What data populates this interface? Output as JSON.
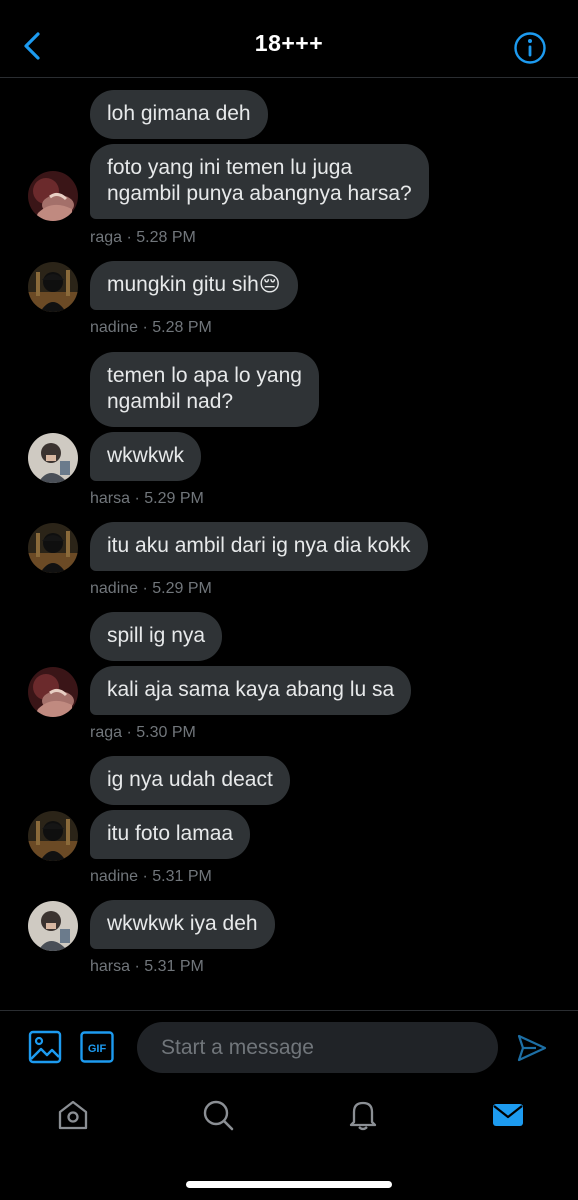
{
  "header": {
    "title": "18+++",
    "back_icon": "chevron-left-icon",
    "info_icon": "info-circle-icon",
    "accent_color": "#1d9bf0"
  },
  "messages": [
    {
      "text": "loh gimana deh"
    },
    {
      "text": "foto yang ini temen lu juga\nngambil punya abangnya harsa?"
    },
    {
      "meta": "raga · 5.28 PM"
    },
    {
      "text": "mungkin gitu sih😔"
    },
    {
      "meta": "nadine · 5.28 PM"
    },
    {
      "text": "temen lo apa lo yang\nngambil nad?"
    },
    {
      "text": "wkwkwk"
    },
    {
      "meta": "harsa · 5.29 PM"
    },
    {
      "text": "itu aku ambil dari ig nya dia kokk"
    },
    {
      "meta": "nadine · 5.29 PM"
    },
    {
      "text": "spill ig nya"
    },
    {
      "text": "kali aja sama kaya abang lu sa"
    },
    {
      "meta": "raga · 5.30 PM"
    },
    {
      "text": "ig nya udah deact"
    },
    {
      "text": "itu foto lamaa"
    },
    {
      "meta": "nadine · 5.31 PM"
    },
    {
      "text": "wkwkwk iya deh"
    },
    {
      "meta": "harsa · 5.31 PM"
    }
  ],
  "composer": {
    "placeholder": "Start a message",
    "media_icon": "image-icon",
    "gif_icon": "gif-icon",
    "gif_label": "GIF",
    "send_icon": "send-icon"
  },
  "tabbar": {
    "items": [
      "home-icon",
      "search-icon",
      "notifications-bell-icon",
      "messages-envelope-icon"
    ],
    "active": "messages-envelope-icon"
  },
  "colors": {
    "bubble_bg": "#2f3336",
    "meta_text": "#71767b",
    "background": "#000000"
  }
}
